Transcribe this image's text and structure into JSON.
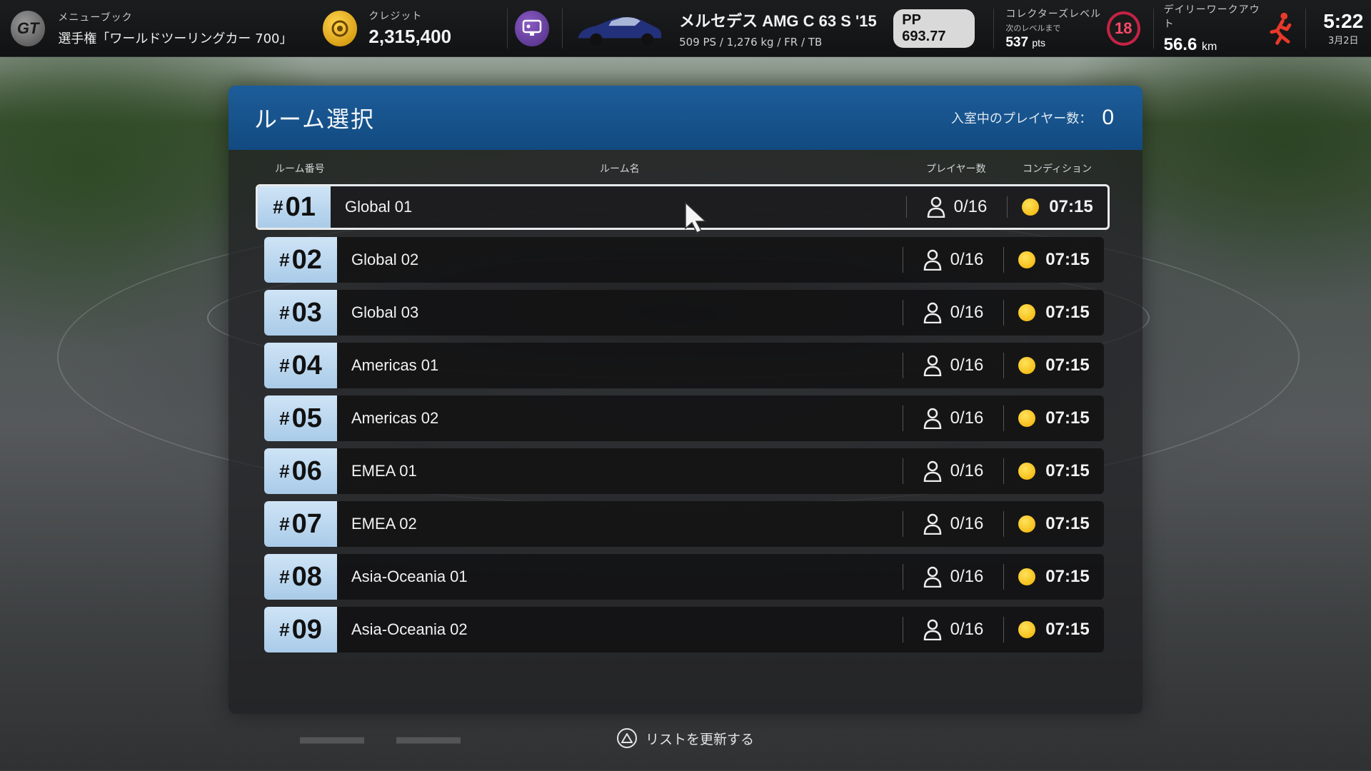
{
  "hud": {
    "menubook_label": "メニューブック",
    "menubook_value": "選手権「ワールドツーリングカー 700」",
    "credit_label": "クレジット",
    "credit_value": "2,315,400",
    "car_name": "メルセデス AMG C 63 S '15",
    "car_specs": "509 PS / 1,276 kg / FR / TB",
    "pp": "PP 693.77",
    "collector_label": "コレクターズレベル",
    "collector_next": "次のレベルまで",
    "collector_pts": "537",
    "collector_pts_unit": "pts",
    "collector_level": "18",
    "workout_label": "デイリーワークアウト",
    "workout_distance": "56.6",
    "workout_unit": "km",
    "time": "5:22",
    "date": "3月2日"
  },
  "panel": {
    "title": "ルーム選択",
    "players_in_label": "入室中のプレイヤー数：",
    "players_in_value": "0",
    "columns": {
      "number": "ルーム番号",
      "name": "ルーム名",
      "players": "プレイヤー数",
      "condition": "コンディション"
    },
    "rooms": [
      {
        "number": "01",
        "name": "Global 01",
        "players": "0/16",
        "time": "07:15"
      },
      {
        "number": "02",
        "name": "Global 02",
        "players": "0/16",
        "time": "07:15"
      },
      {
        "number": "03",
        "name": "Global 03",
        "players": "0/16",
        "time": "07:15"
      },
      {
        "number": "04",
        "name": "Americas 01",
        "players": "0/16",
        "time": "07:15"
      },
      {
        "number": "05",
        "name": "Americas 02",
        "players": "0/16",
        "time": "07:15"
      },
      {
        "number": "06",
        "name": "EMEA 01",
        "players": "0/16",
        "time": "07:15"
      },
      {
        "number": "07",
        "name": "EMEA 02",
        "players": "0/16",
        "time": "07:15"
      },
      {
        "number": "08",
        "name": "Asia-Oceania 01",
        "players": "0/16",
        "time": "07:15"
      },
      {
        "number": "09",
        "name": "Asia-Oceania 02",
        "players": "0/16",
        "time": "07:15"
      }
    ]
  },
  "footer": {
    "refresh_label": "リストを更新する"
  },
  "colors": {
    "header_blue": "#1d5d9a",
    "room_number_bg": "#a9cbe8",
    "sun": "#f2b000",
    "level_ring": "#c42345"
  }
}
